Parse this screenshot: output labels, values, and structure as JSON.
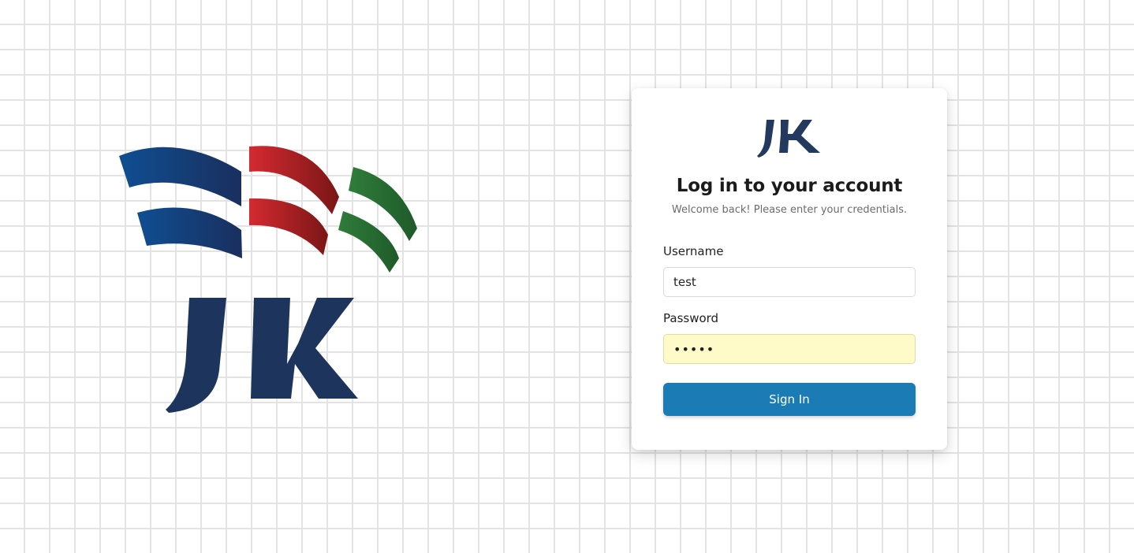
{
  "brand": {
    "logo_text": "JK",
    "colors": {
      "navy": "#1d355d",
      "blue": "#0f4b8f",
      "red": "#c8232c",
      "green": "#2f7a3a"
    }
  },
  "login": {
    "title": "Log in to your account",
    "subtitle": "Welcome back! Please enter your credentials.",
    "username": {
      "label": "Username",
      "value": "test"
    },
    "password": {
      "label": "Password",
      "value": "•••••"
    },
    "submit_label": "Sign In",
    "accent_color": "#1b7bb5"
  }
}
